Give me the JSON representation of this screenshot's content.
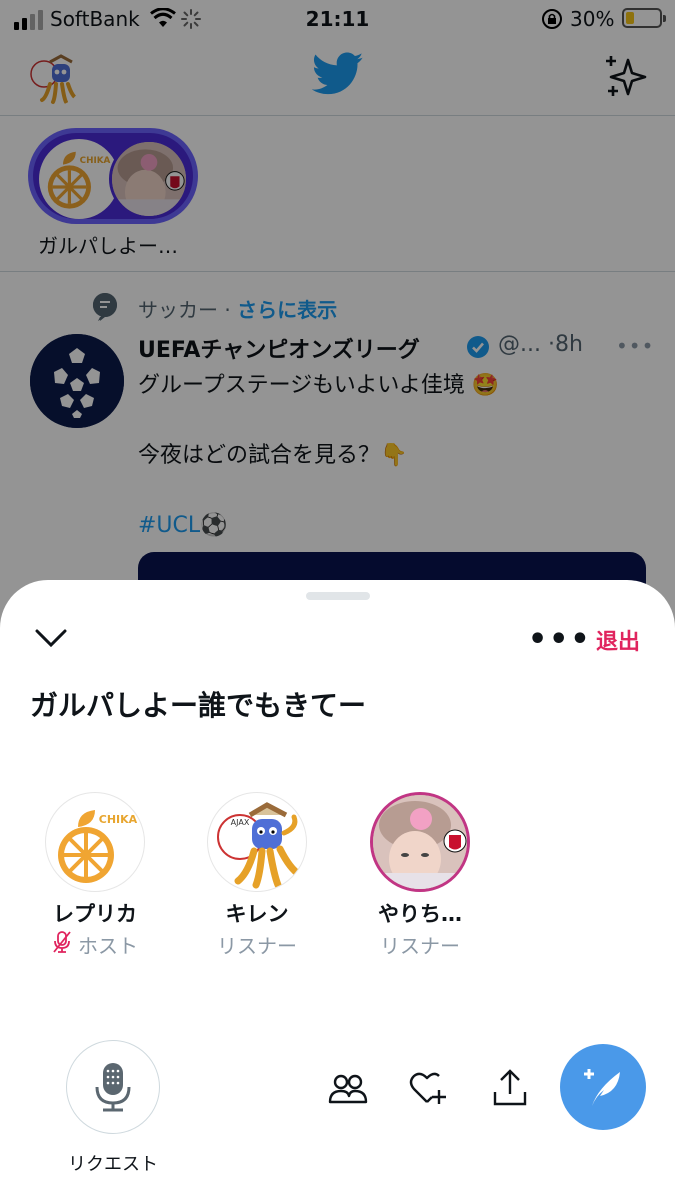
{
  "status_bar": {
    "carrier": "SoftBank",
    "time": "21:11",
    "battery_percent": "30%"
  },
  "fleet": {
    "space_label": "ガルパしよー…",
    "host_logo_text": "CHIKA"
  },
  "tweet": {
    "topic": "サッカー",
    "topic_separator": "·",
    "topic_more": "さらに表示",
    "author_name": "UEFAチャンピオンズリーグ",
    "author_handle": "@...",
    "time": "·8h",
    "menu_dots": "•••",
    "line1": "グループステージもいよいよ佳境 🤩",
    "line2": "今夜はどの試合を見る？👇",
    "hashtag": "#UCL",
    "hashtag_emoji": "⚽"
  },
  "space": {
    "more_label": "•••",
    "leave_label": "退出",
    "title": "ガルパしよー誰でもきてー",
    "participants": [
      {
        "name": "レプリカ",
        "role": "ホスト",
        "muted": true
      },
      {
        "name": "キレン",
        "role": "リスナー"
      },
      {
        "name": "やりち…",
        "role": "リスナー"
      }
    ],
    "request_label": "リクエスト",
    "host_logo_text": "CHIKA"
  },
  "colors": {
    "twitter_blue": "#1d9bf0",
    "leave_red": "#e0245e",
    "host_ring": "#6c63ff",
    "fab": "#4a99e9",
    "muted_pink": "#e0245e"
  }
}
